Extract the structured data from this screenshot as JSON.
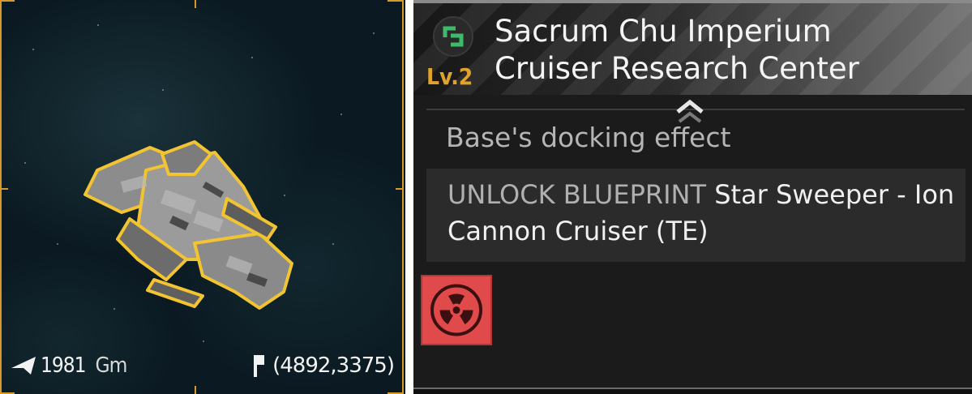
{
  "viewport": {
    "distance_value": "1981",
    "distance_unit": "Gm",
    "coordinates": "(4892,3375)",
    "frame_color": "#d79a2a",
    "icons": [
      "distance-arrow-icon",
      "map-pin-icon",
      "cruiser-ship"
    ]
  },
  "base": {
    "level": "Lv.2",
    "title_line1": "Sacrum Chu Imperium",
    "title_line2": "Cruiser Research Center",
    "icon": "base-module-icon",
    "icon_color": "#3dbb6a"
  },
  "docking": {
    "section_label": "Base's docking effect",
    "effect_prefix": "UNLOCK BLUEPRINT",
    "effect_value": "Star Sweeper - Ion Cannon Cruiser (TE)",
    "effect_icon": "radiation-icon",
    "effect_icon_bg": "#e04a4a"
  },
  "colors": {
    "accent_gold": "#e0a22c",
    "panel_bg": "#1b1b1b"
  }
}
